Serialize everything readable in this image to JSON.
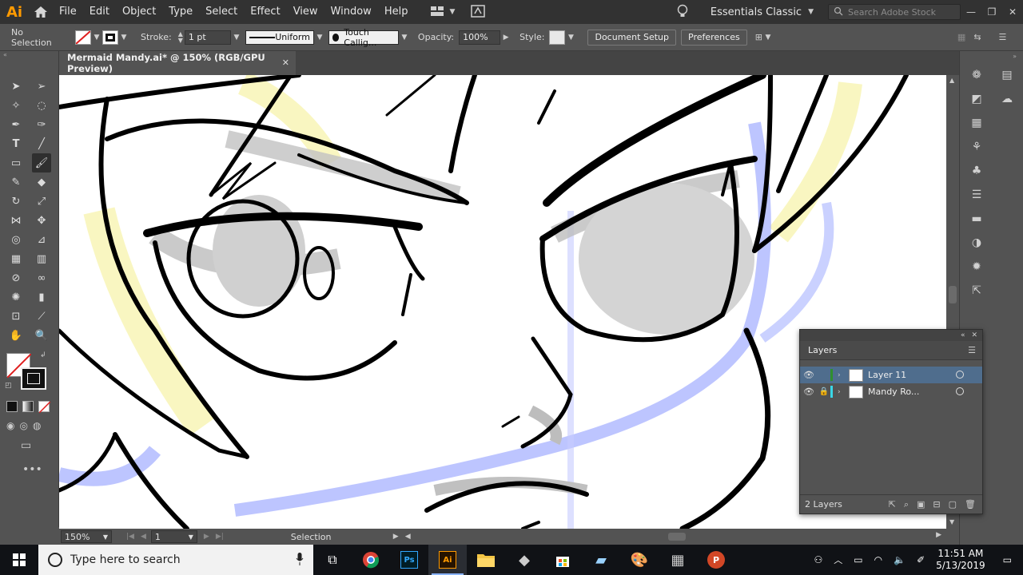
{
  "menubar": {
    "logo": "Ai",
    "items": [
      "File",
      "Edit",
      "Object",
      "Type",
      "Select",
      "Effect",
      "View",
      "Window",
      "Help"
    ],
    "workspace": "Essentials Classic",
    "stock_placeholder": "Search Adobe Stock"
  },
  "controlbar": {
    "selection_label": "No Selection",
    "stroke_label": "Stroke:",
    "stroke_weight": "1 pt",
    "profile": "Uniform",
    "brush": "Touch Callig...",
    "opacity_label": "Opacity:",
    "opacity_value": "100%",
    "style_label": "Style:",
    "doc_setup": "Document Setup",
    "preferences": "Preferences"
  },
  "document": {
    "tab_title": "Mermaid Mandy.ai* @ 150% (RGB/GPU Preview)"
  },
  "statusbar": {
    "zoom": "150%",
    "artboard": "1",
    "tool": "Selection"
  },
  "layers": {
    "panel_title": "Layers",
    "rows": [
      {
        "name": "Layer 11",
        "color": "#2f8f2f",
        "selected": true
      },
      {
        "name": "Mandy Ro...",
        "color": "#3ad6e6",
        "selected": false
      }
    ],
    "count": "2 Layers"
  },
  "taskbar": {
    "search_placeholder": "Type here to search",
    "time": "11:51 AM",
    "date": "5/13/2019"
  },
  "colors": {
    "ai_orange": "#ff9a00",
    "selection_blue": "#4f6d8d",
    "sketch_blue": "#a7b2ff",
    "sketch_yellow": "#f7f2a6"
  }
}
